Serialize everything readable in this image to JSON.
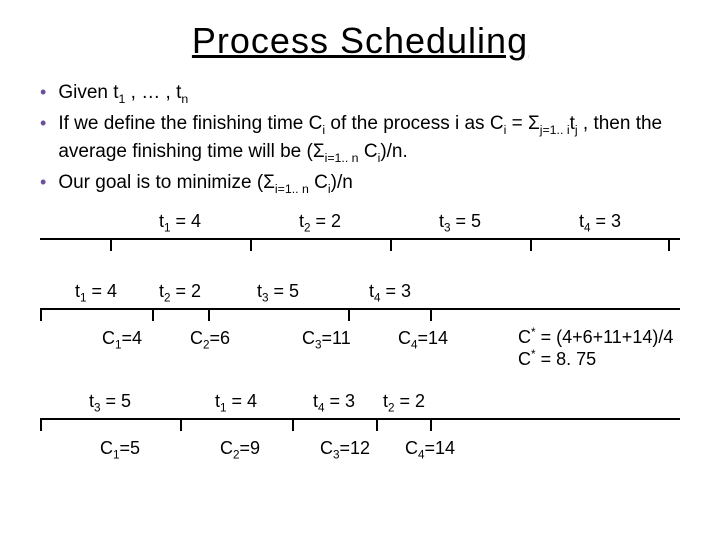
{
  "title": "Process Scheduling",
  "bullets": {
    "b1": "Given t<sub>1</sub> , … , t<sub>n</sub>",
    "b2": "If we define the finishing time C<sub>i</sub> of the process i as C<sub>i</sub> = Σ<sub>j=1.. i</sub>t<sub>j</sub> , then the average finishing time will be  (Σ<sub>i=1.. n</sub> C<sub>i</sub>)/n.",
    "b3": "Our goal is to minimize (Σ<sub>i=1.. n</sub> C<sub>i</sub>)/n"
  },
  "timeline1": {
    "s1": "t<sub>1</sub> = 4",
    "s2": "t<sub>2</sub> = 2",
    "s3": "t<sub>3</sub> = 5",
    "s4": "t<sub>4</sub> = 3"
  },
  "timeline2": {
    "s1": "t<sub>1</sub> = 4",
    "s2": "t<sub>2</sub> = 2",
    "s3": "t<sub>3</sub> = 5",
    "s4": "t<sub>4</sub> = 3",
    "c1": "C<sub>1</sub>=4",
    "c2": "C<sub>2</sub>=6",
    "c3": "C<sub>3</sub>=11",
    "c4": "C<sub>4</sub>=14"
  },
  "note": {
    "l1": "C<sup>*</sup> = (4+6+11+14)/4",
    "l2": "C<sup>*</sup> = 8. 75"
  },
  "timeline3": {
    "s1": "t<sub>3</sub> = 5",
    "s2": "t<sub>1</sub> = 4",
    "s3": "t<sub>4</sub> = 3",
    "s4": "t<sub>2</sub> = 2",
    "c1": "C<sub>1</sub>=5",
    "c2": "C<sub>2</sub>=9",
    "c3": "C<sub>3</sub>=12",
    "c4": "C<sub>4</sub>=14"
  },
  "chart_data": {
    "type": "table",
    "tasks": [
      {
        "name": "t1",
        "duration": 4
      },
      {
        "name": "t2",
        "duration": 2
      },
      {
        "name": "t3",
        "duration": 5
      },
      {
        "name": "t4",
        "duration": 3
      }
    ],
    "schedule_equal_spacing": {
      "order": [
        "t1",
        "t2",
        "t3",
        "t4"
      ],
      "finishing_times": [
        4,
        2,
        5,
        3
      ]
    },
    "schedule_given_order": {
      "order": [
        "t1",
        "t2",
        "t3",
        "t4"
      ],
      "finishing_times": [
        4,
        6,
        11,
        14
      ],
      "average": 8.75
    },
    "schedule_reversed": {
      "order": [
        "t3",
        "t1",
        "t4",
        "t2"
      ],
      "finishing_times": [
        5,
        9,
        12,
        14
      ]
    }
  }
}
